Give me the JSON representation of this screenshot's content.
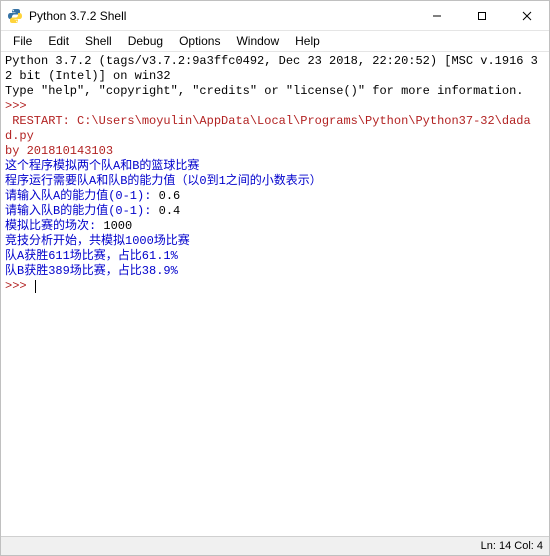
{
  "window": {
    "title": "Python 3.7.2 Shell"
  },
  "menu": {
    "items": [
      "File",
      "Edit",
      "Shell",
      "Debug",
      "Options",
      "Window",
      "Help"
    ]
  },
  "console": {
    "header_line1": "Python 3.7.2 (tags/v3.7.2:9a3ffc0492, Dec 23 2018, 22:20:52) [MSC v.1916 32 bit (Intel)] on win32",
    "header_line2": "Type \"help\", \"copyright\", \"credits\" or \"license()\" for more information.",
    "prompt": ">>> ",
    "restart_line": " RESTART: C:\\Users\\moyulin\\AppData\\Local\\Programs\\Python\\Python37-32\\dadad.py",
    "by_line": "by 201810143103",
    "out1": "这个程序模拟两个队A和B的篮球比赛",
    "out2": "程序运行需要队A和队B的能力值（以0到1之间的小数表示）",
    "in1_label": "请输入队A的能力值(0-1): ",
    "in1_value": "0.6",
    "in2_label": "请输入队B的能力值(0-1): ",
    "in2_value": "0.4",
    "in3_label": "模拟比赛的场次: ",
    "in3_value": "1000",
    "out3": "竞技分析开始，共模拟1000场比赛",
    "out4": "队A获胜611场比赛，占比61.1%",
    "out5": "队B获胜389场比赛，占比38.9%"
  },
  "status": {
    "position": "Ln: 14  Col: 4"
  }
}
